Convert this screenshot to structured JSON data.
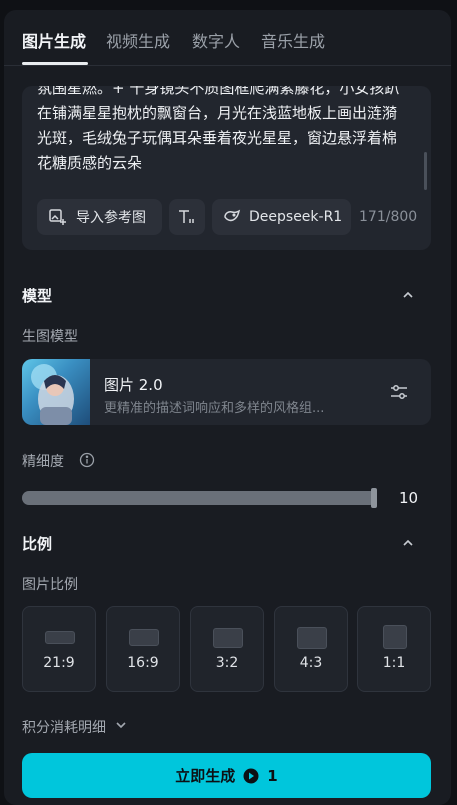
{
  "tabs": [
    {
      "label": "图片生成",
      "active": true
    },
    {
      "label": "视频生成",
      "active": false
    },
    {
      "label": "数字人",
      "active": false
    },
    {
      "label": "音乐生成",
      "active": false
    }
  ],
  "prompt": {
    "text": "氛围星燃。+ 十身镜头不质图框爬满紫藤花，小女孩趴在铺满星星抱枕的飘窗台，月光在浅蓝地板上画出涟漪光斑，毛绒兔子玩偶耳朵垂着夜光星星，窗边悬浮着棉花糖质感的云朵",
    "import_ref_label": "导入参考图",
    "llm_label": "Deepseek-R1",
    "counter": "171/800"
  },
  "model_section": {
    "title": "模型",
    "sub_label": "生图模型",
    "model_name": "图片 2.0",
    "model_desc": "更精准的描述词响应和多样的风格组..."
  },
  "detail": {
    "label": "精细度",
    "value": "10",
    "level": 1.0
  },
  "ratio_section": {
    "title": "比例",
    "sub_label": "图片比例",
    "options": [
      "21:9",
      "16:9",
      "3:2",
      "4:3",
      "1:1"
    ]
  },
  "cost_label": "积分消耗明细",
  "generate": {
    "label": "立即生成",
    "cost": "1"
  },
  "colors": {
    "accent": "#00c6dc",
    "panel": "#191c22",
    "card": "#22262e"
  }
}
